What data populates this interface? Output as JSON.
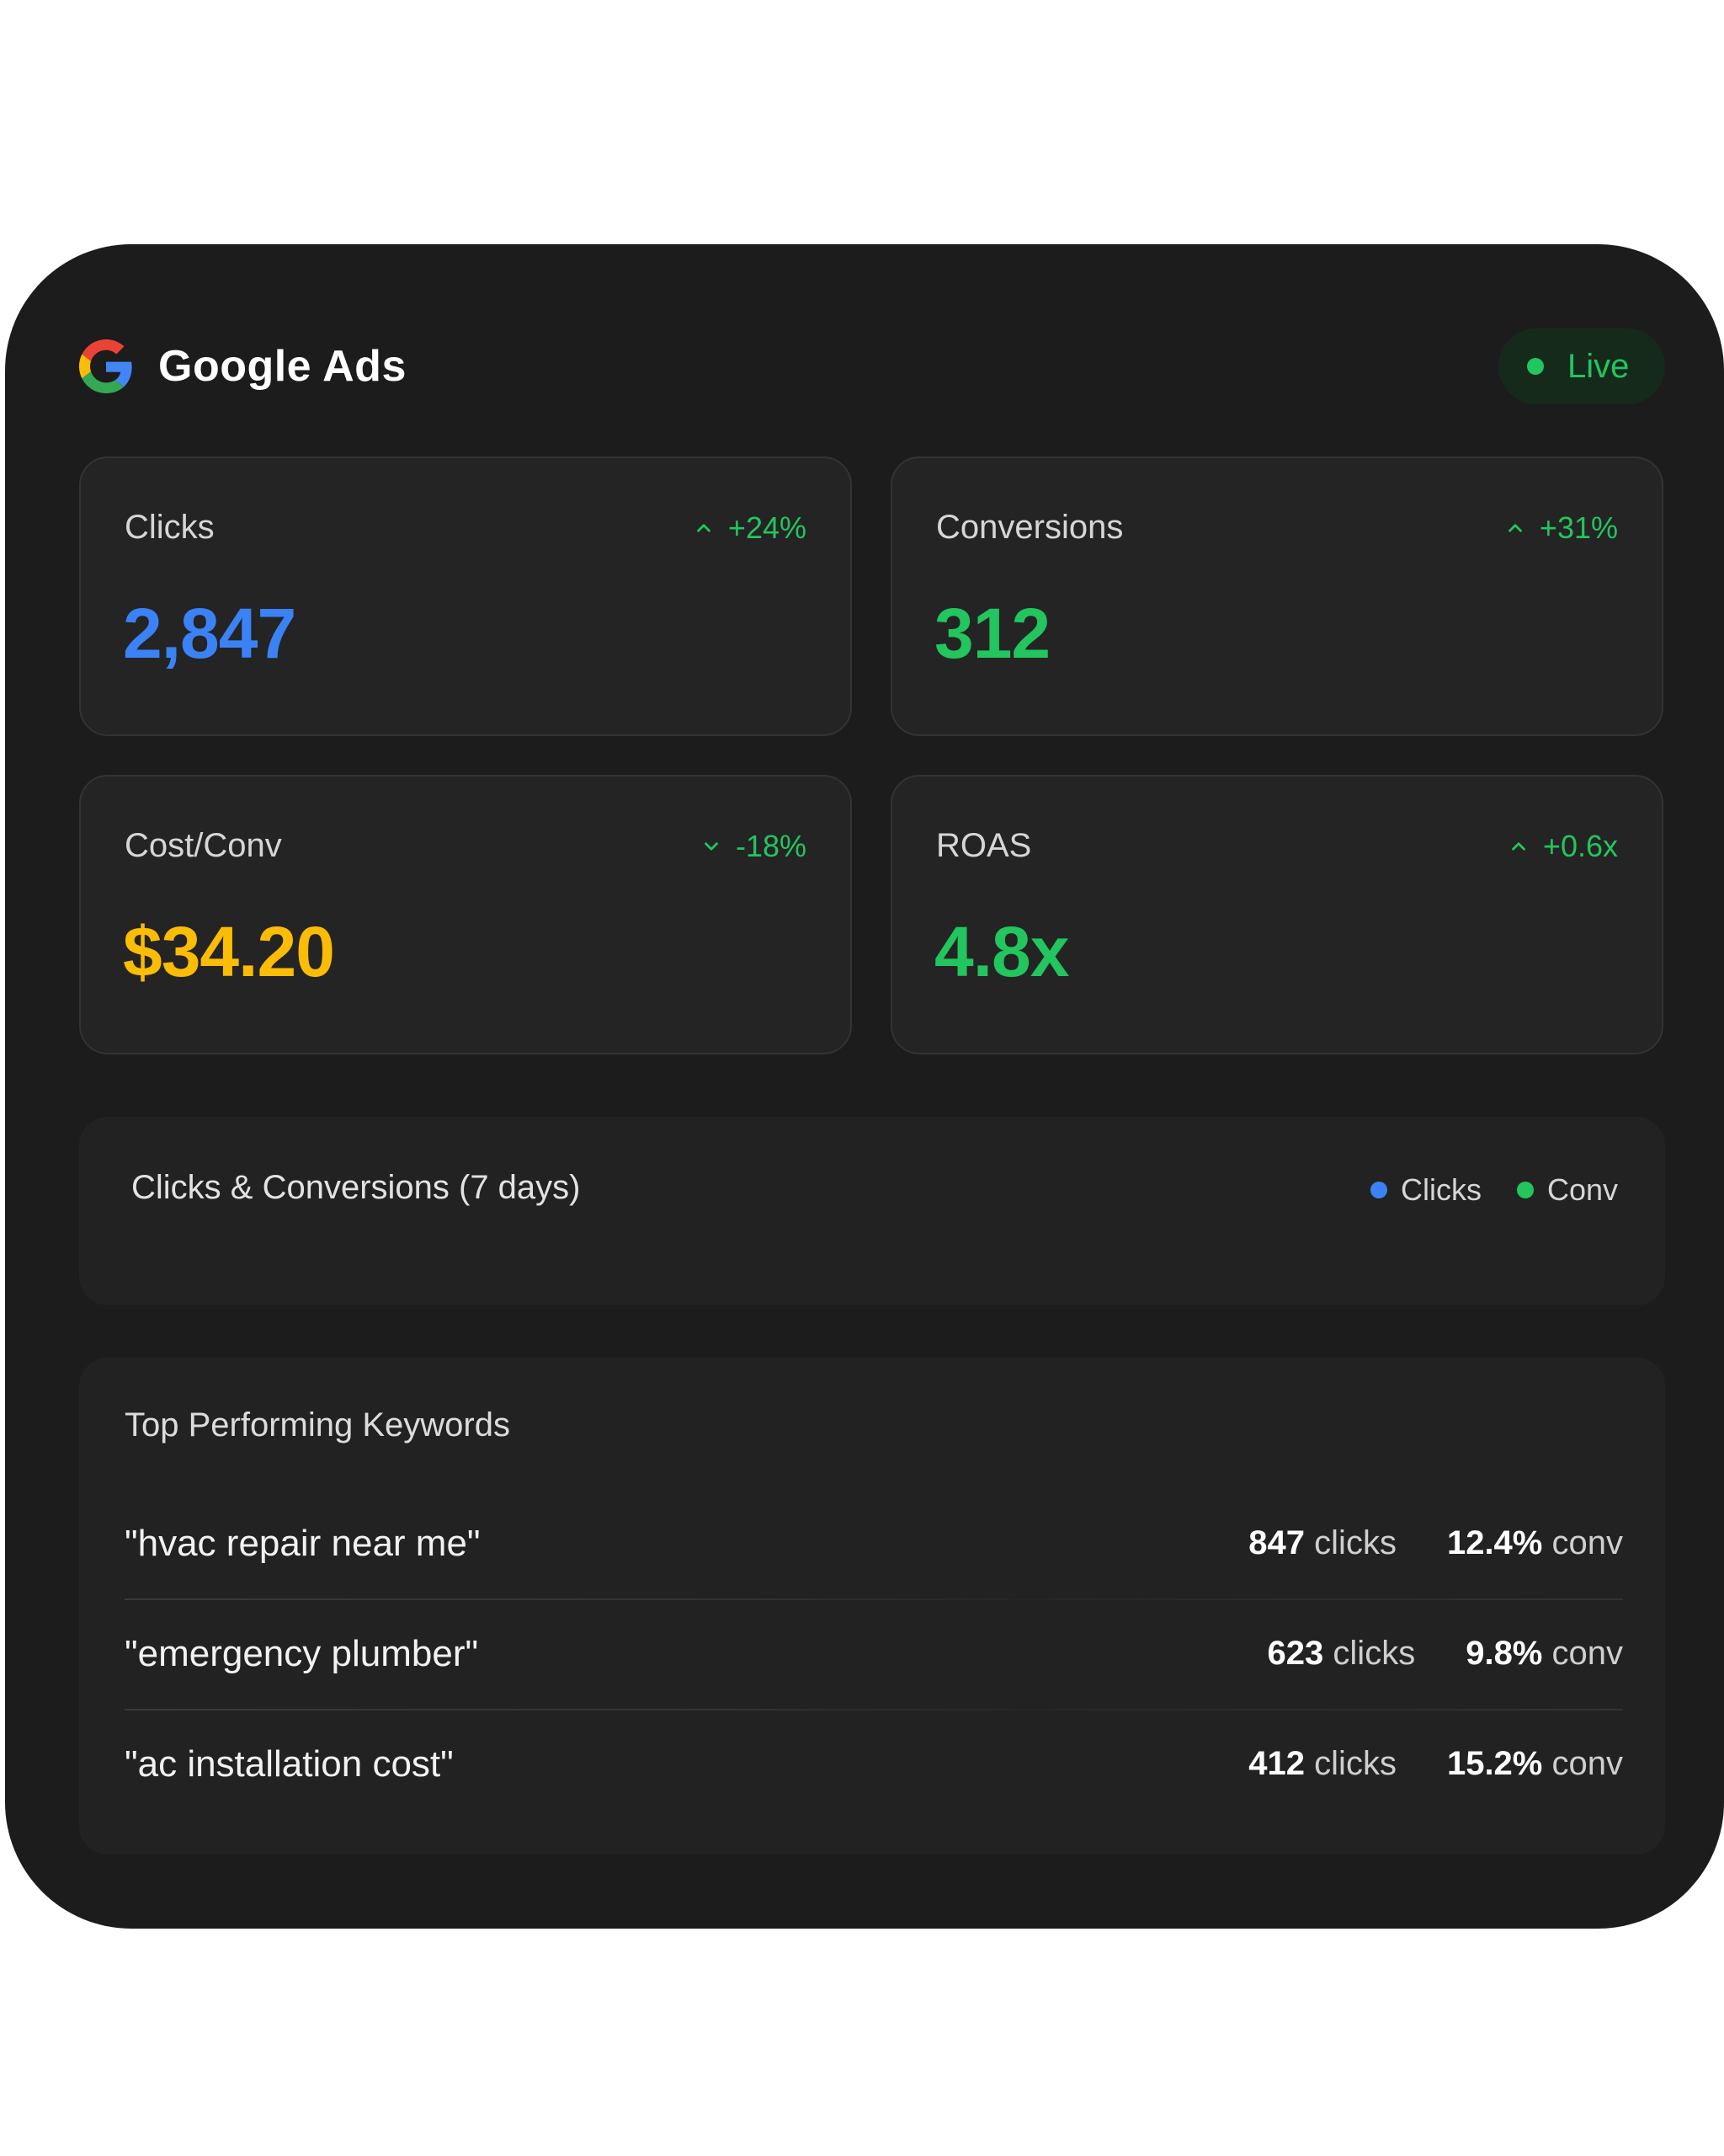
{
  "header": {
    "title": "Google Ads",
    "logo_icon": "google-g-icon",
    "status": {
      "label": "Live",
      "color": "#22c55e"
    }
  },
  "metrics": [
    {
      "label": "Clicks",
      "change": "+24%",
      "direction": "up",
      "value": "2,847",
      "value_color": "#3b82f6"
    },
    {
      "label": "Conversions",
      "change": "+31%",
      "direction": "up",
      "value": "312",
      "value_color": "#22c55e"
    },
    {
      "label": "Cost/Conv",
      "change": "-18%",
      "direction": "down",
      "value": "$34.20",
      "value_color": "#fbbc05"
    },
    {
      "label": "ROAS",
      "change": "+0.6x",
      "direction": "up",
      "value": "4.8x",
      "value_color": "#22c55e"
    }
  ],
  "chart": {
    "title": "Clicks & Conversions (7 days)",
    "legend": [
      {
        "label": "Clicks",
        "color": "#3b82f6"
      },
      {
        "label": "Conv",
        "color": "#22c55e"
      }
    ]
  },
  "keywords": {
    "title": "Top Performing Keywords",
    "rows": [
      {
        "keyword": "\"hvac repair near me\"",
        "clicks": "847",
        "clicks_unit": "clicks",
        "conv": "12.4%",
        "conv_unit": "conv"
      },
      {
        "keyword": "\"emergency plumber\"",
        "clicks": "623",
        "clicks_unit": "clicks",
        "conv": "9.8%",
        "conv_unit": "conv"
      },
      {
        "keyword": "\"ac installation cost\"",
        "clicks": "412",
        "clicks_unit": "clicks",
        "conv": "15.2%",
        "conv_unit": "conv"
      }
    ]
  },
  "colors": {
    "panel_background": "#1c1c1c",
    "card_background": "#242424",
    "positive": "#22c55e"
  }
}
